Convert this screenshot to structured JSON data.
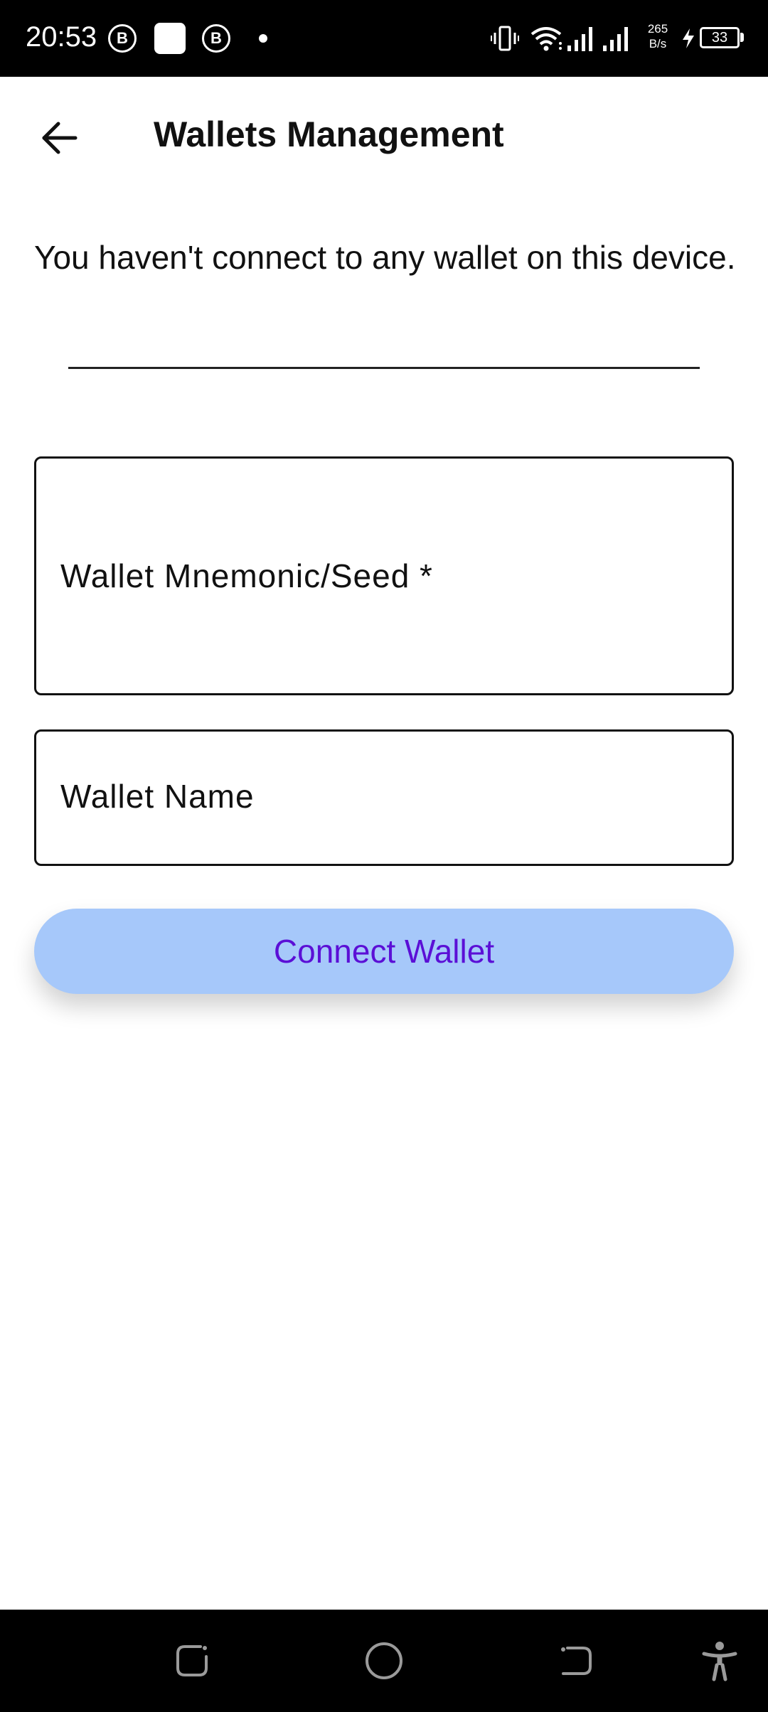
{
  "status_bar": {
    "time": "20:53",
    "notif_badge_1": "B",
    "notif_badge_2": "B",
    "net_speed_value": "265",
    "net_speed_unit": "B/s",
    "battery_level": "33",
    "icons": [
      "b-badge-icon",
      "app-square-icon",
      "b-badge-icon",
      "dot-icon",
      "vibrate-icon",
      "wifi-icon",
      "signal-icon",
      "signal-icon",
      "charging-icon",
      "battery-icon"
    ]
  },
  "app_bar": {
    "title": "Wallets Management",
    "back_icon": "arrow-left-icon"
  },
  "main": {
    "info_text": "You haven't connect to any wallet on this device.",
    "seed_field_label": "Wallet Mnemonic/Seed *",
    "name_field_label": "Wallet Name",
    "connect_button_label": "Connect Wallet"
  },
  "nav_bar": {
    "icons": [
      "recents-icon",
      "home-icon",
      "back-icon",
      "accessibility-icon"
    ]
  },
  "colors": {
    "button_bg": "#a6c8fa",
    "button_text": "#5b0fd6",
    "bars": "#000000"
  }
}
